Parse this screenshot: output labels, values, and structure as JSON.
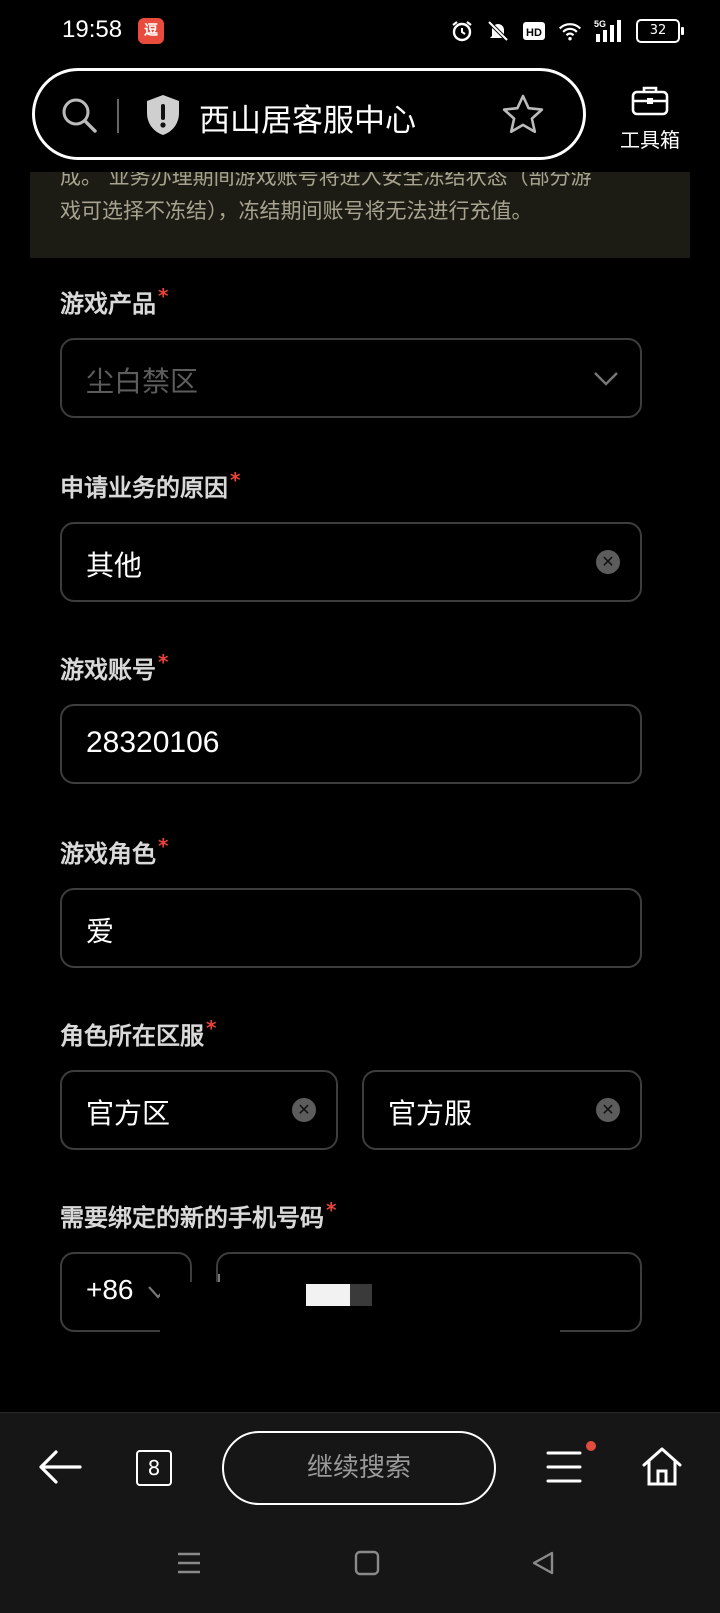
{
  "status_bar": {
    "time": "19:58",
    "app_badge": "逗",
    "battery": "32",
    "network": "5G",
    "hd": "HD"
  },
  "browser": {
    "site_title": "西山居客服中心",
    "toolbox_label": "工具箱"
  },
  "notice": {
    "line1": "成。 业务办理期间游戏账号将进入安全冻结状态（部分游",
    "line2": "戏可选择不冻结），冻结期间账号将无法进行充值。"
  },
  "form": {
    "required_mark": "*",
    "game_product": {
      "label": "游戏产品",
      "value": "尘白禁区"
    },
    "reason": {
      "label": "申请业务的原因",
      "value": "其他"
    },
    "account": {
      "label": "游戏账号",
      "value": "28320106"
    },
    "role": {
      "label": "游戏角色",
      "value": "爱"
    },
    "server": {
      "label": "角色所在区服",
      "region": "官方区",
      "server": "官方服"
    },
    "phone": {
      "label": "需要绑定的新的手机号码",
      "country_code": "+86"
    }
  },
  "bottom_nav": {
    "tab_count": "8",
    "continue_label": "继续搜索"
  }
}
